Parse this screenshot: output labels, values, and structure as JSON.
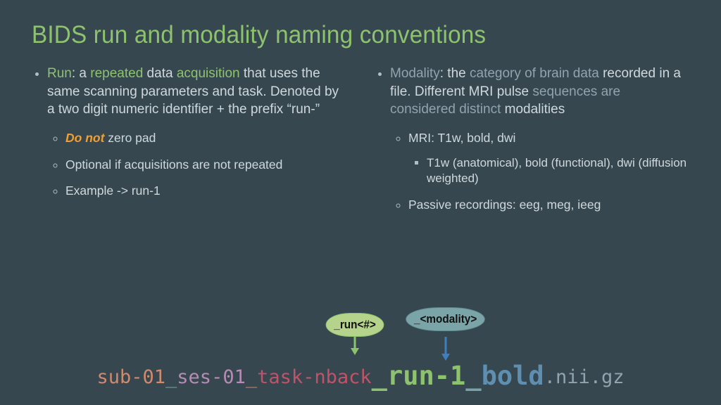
{
  "title": "BIDS run and modality naming conventions",
  "left": {
    "lead_html": "<span class='k1'>Run</span>: a <span class='k1'>repeated</span> data <span class='k1'>acquisition</span> that uses the same scanning parameters and task. Denoted by a two digit numeric identifier + the prefix “run-”",
    "b1_html": "<span class='donot'>Do not</span> zero pad",
    "b2": "Optional if acquisitions are not repeated",
    "b3": "Example -> run-1"
  },
  "right": {
    "lead_html": "<span class='k2'>Modality</span>: the <span class='k2'>category of brain data</span> recorded in a file. Different MRI pulse <span class='k2'>sequences are considered distinct</span> modalities",
    "b1": "MRI: T1w, bold, dwi",
    "b1a": "T1w (anatomical), bold (functional), dwi (diffusion weighted)",
    "b2": "Passive recordings: eeg, meg, ieeg"
  },
  "bubbles": {
    "run": "_run<#>",
    "mod": "_<modality>"
  },
  "code": {
    "sub": "sub-01",
    "us1": "_",
    "ses": "ses-01",
    "us2": "_",
    "task": "task-nback",
    "run": "_run-1",
    "us3": "_",
    "bold": "bold",
    "ext": ".nii.gz"
  }
}
